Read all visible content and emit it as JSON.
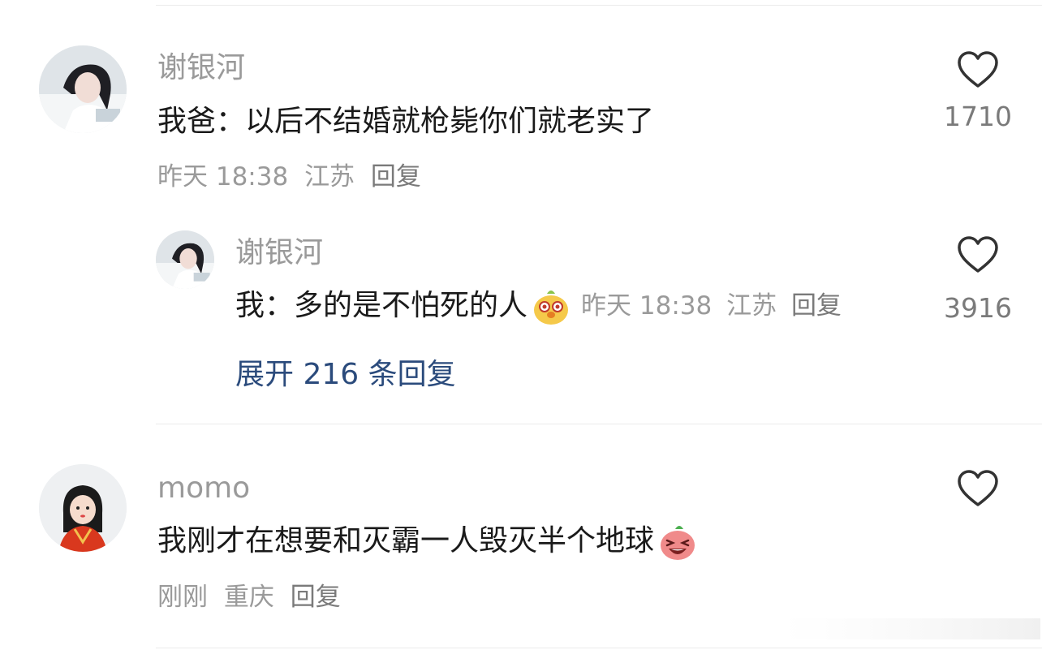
{
  "comments": [
    {
      "username": "谢银河",
      "content": "我爸：以后不结婚就枪毙你们就老实了",
      "time": "昨天 18:38",
      "location": "江苏",
      "reply_label": "回复",
      "like_count": "1710",
      "replies": [
        {
          "username": "谢银河",
          "content": "我：多的是不怕死的人",
          "emoji": "chick-emoji",
          "time": "昨天 18:38",
          "location": "江苏",
          "reply_label": "回复",
          "like_count": "3916"
        }
      ],
      "expand_label": "展开 216 条回复"
    },
    {
      "username": "momo",
      "content": "我刚才在想要和灭霸一人毁灭半个地球",
      "emoji": "laughing-emoji",
      "time": "刚刚",
      "location": "重庆",
      "reply_label": "回复"
    }
  ],
  "icons": {
    "like": "heart-outline-icon"
  },
  "colors": {
    "link": "#2b4b7c",
    "meta": "#9a9a9a",
    "text": "#1a1a1a"
  }
}
